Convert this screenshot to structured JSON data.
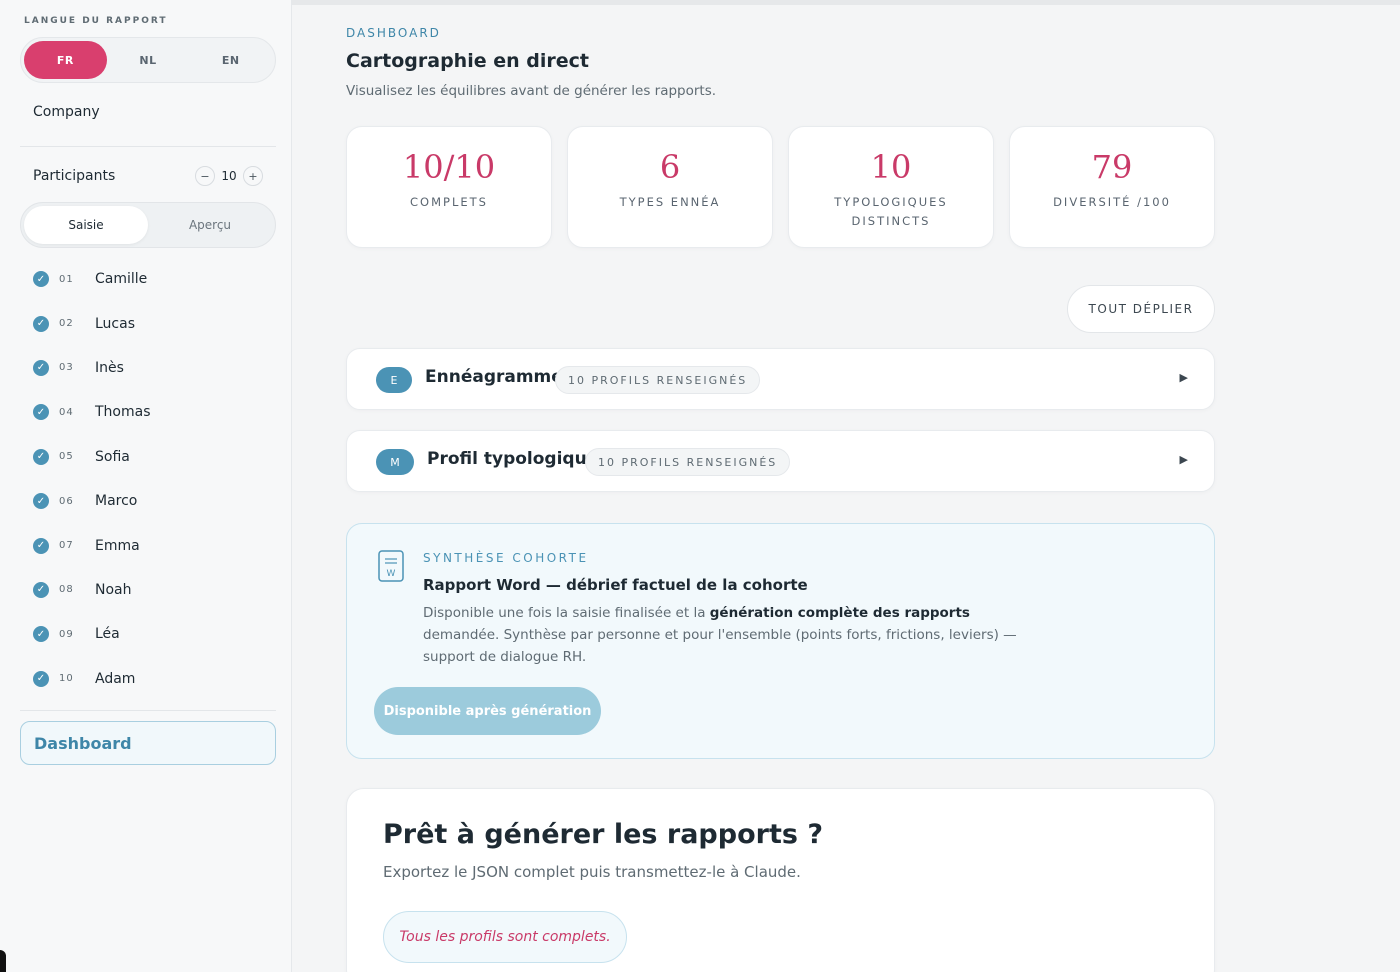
{
  "sidebar": {
    "lang_label": "LANGUE DU RAPPORT",
    "languages": [
      "FR",
      "NL",
      "EN"
    ],
    "active_language": "FR",
    "company_label": "Company",
    "participants_label": "Participants",
    "participants_minus": "−",
    "participants_count": "10",
    "participants_plus": "+",
    "modes": [
      "Saisie",
      "Aperçu"
    ],
    "active_mode": "Saisie",
    "participants": [
      {
        "num": "01",
        "name": "Camille"
      },
      {
        "num": "02",
        "name": "Lucas"
      },
      {
        "num": "03",
        "name": "Inès"
      },
      {
        "num": "04",
        "name": "Thomas"
      },
      {
        "num": "05",
        "name": "Sofia"
      },
      {
        "num": "06",
        "name": "Marco"
      },
      {
        "num": "07",
        "name": "Emma"
      },
      {
        "num": "08",
        "name": "Noah"
      },
      {
        "num": "09",
        "name": "Léa"
      },
      {
        "num": "10",
        "name": "Adam"
      }
    ],
    "dashboard_label": "Dashboard"
  },
  "main": {
    "eyebrow": "DASHBOARD",
    "title": "Cartographie en direct",
    "subtitle": "Visualisez les équilibres avant de générer les rapports.",
    "stats": [
      {
        "value": "10/10",
        "label": "COMPLETS"
      },
      {
        "value": "6",
        "label": "TYPES ENNÉA"
      },
      {
        "value": "10",
        "label": "TYPOLOGIQUES DISTINCTS"
      },
      {
        "value": "79",
        "label": "DIVERSITÉ /100"
      }
    ],
    "expand_all": "TOUT DÉPLIER",
    "accordions": [
      {
        "badge": "E",
        "title": "Ennéagramme",
        "pill": "10 PROFILS RENSEIGNÉS",
        "arrow": "▶"
      },
      {
        "badge": "M",
        "title": "Profil typologique",
        "pill": "10 PROFILS RENSEIGNÉS",
        "arrow": "▶"
      }
    ],
    "synthesis": {
      "eyebrow": "SYNTHÈSE COHORTE",
      "title": "Rapport Word — débrief factuel de la cohorte",
      "body_pre": "Disponible une fois la saisie finalisée et la ",
      "body_bold": "génération complète des rapports",
      "body_post": " demandée. Synthèse par personne et pour l'ensemble (points forts, frictions, leviers) — support de dialogue RH.",
      "button": "Disponible après génération",
      "icon_letter": "W"
    },
    "ready": {
      "title": "Prêt à générer les rapports ?",
      "subtitle": "Exportez le JSON complet puis transmettez-le à Claude.",
      "status": "Tous les profils sont complets."
    }
  },
  "colors": {
    "accent_pink": "#d93f6e",
    "accent_blue": "#4b93b5",
    "stat_value": "#c93a68"
  }
}
